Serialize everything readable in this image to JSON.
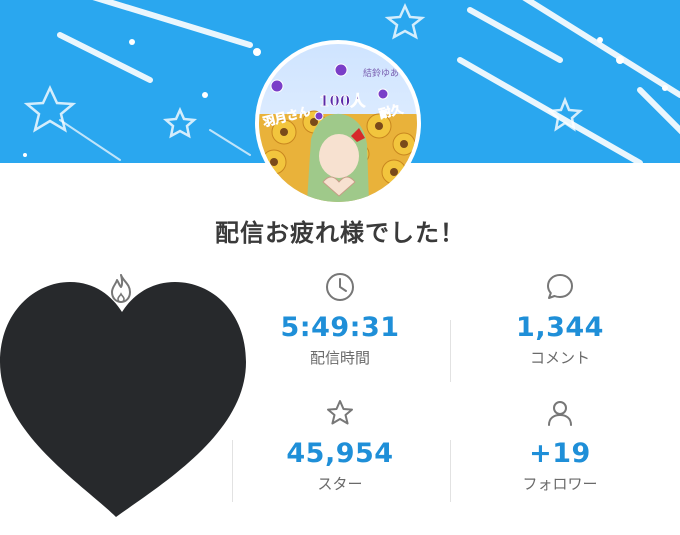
{
  "header": {
    "banner_color": "#2aa7ef",
    "avatar_texts": [
      "結鈴ゆあ",
      "羽月さん",
      "100人",
      "耐久"
    ]
  },
  "title": "配信お疲れ様でした！",
  "stats": [
    {
      "icon": "clock-icon",
      "value": "5:49:31",
      "label": "配信時間"
    },
    {
      "icon": "comment-icon",
      "value": "1,344",
      "label": "コメント"
    },
    {
      "icon": "star-icon",
      "value": "45,954",
      "label": "スター"
    },
    {
      "icon": "person-icon",
      "value": "+19",
      "label": "フォロワー"
    }
  ],
  "accent_color": "#1f8fd8"
}
